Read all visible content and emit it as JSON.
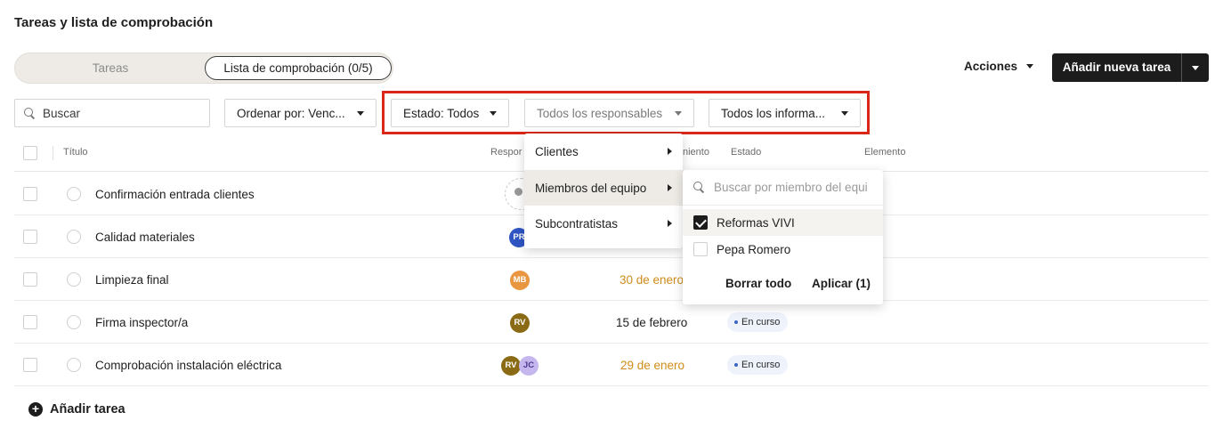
{
  "page": {
    "title": "Tareas y lista de comprobación"
  },
  "tabs": {
    "tareas": "Tareas",
    "lista": "Lista de comprobación (0/5)"
  },
  "actions": {
    "acciones": "Acciones",
    "add_task": "Añadir nueva tarea"
  },
  "filters": {
    "search_placeholder": "Buscar",
    "order": "Ordenar por: Venc...",
    "estado": "Estado: Todos",
    "responsables": "Todos los responsables",
    "informadores": "Todos los informa..."
  },
  "table": {
    "headers": {
      "titulo": "Título",
      "responsable": "Respor",
      "vencimiento": "niento",
      "estado": "Estado",
      "elemento": "Elemento"
    },
    "rows": [
      {
        "title": "Confirmación entrada clientes",
        "date": "",
        "status": ""
      },
      {
        "title": "Calidad materiales",
        "avatars": [
          "PR"
        ],
        "date": "",
        "status": ""
      },
      {
        "title": "Limpieza final",
        "avatars": [
          "MB"
        ],
        "date": "30 de enero",
        "status": ""
      },
      {
        "title": "Firma inspector/a",
        "avatars": [
          "RV"
        ],
        "date": "15 de febrero",
        "status": "En curso"
      },
      {
        "title": "Comprobación instalación eléctrica",
        "avatars": [
          "RV",
          "JC"
        ],
        "date": "29 de enero",
        "status": "En curso"
      }
    ]
  },
  "footer": {
    "add_task": "Añadir tarea"
  },
  "menu": {
    "items": [
      "Clientes",
      "Miembros del equipo",
      "Subcontratistas"
    ],
    "active": "Miembros del equipo"
  },
  "submenu": {
    "search_placeholder": "Buscar por miembro del equi",
    "options": [
      {
        "label": "Reformas VIVI",
        "checked": true
      },
      {
        "label": "Pepa Romero",
        "checked": false
      }
    ],
    "clear": "Borrar todo",
    "apply": "Aplicar (1)"
  },
  "colors": {
    "highlight": "#d9281a",
    "overdue": "#d08c1a",
    "primary": "#1c1c1c"
  }
}
